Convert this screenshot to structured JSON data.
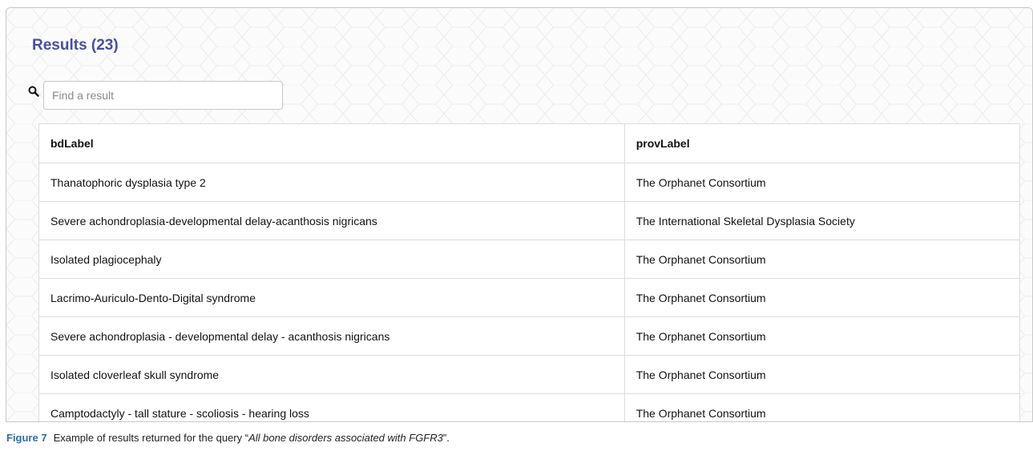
{
  "results": {
    "title": "Results (23)"
  },
  "search": {
    "placeholder": "Find a result",
    "value": "",
    "icon": "search-icon"
  },
  "table": {
    "headers": [
      "bdLabel",
      "provLabel"
    ],
    "rows": [
      [
        "Thanatophoric dysplasia type 2",
        "The Orphanet Consortium"
      ],
      [
        "Severe achondroplasia-developmental delay-acanthosis nigricans",
        "The International Skeletal Dysplasia Society"
      ],
      [
        "Isolated plagiocephaly",
        "The Orphanet Consortium"
      ],
      [
        "Lacrimo-Auriculo-Dento-Digital syndrome",
        "The Orphanet Consortium"
      ],
      [
        "Severe achondroplasia - developmental delay - acanthosis nigricans",
        "The Orphanet Consortium"
      ],
      [
        "Isolated cloverleaf skull syndrome",
        "The Orphanet Consortium"
      ],
      [
        "Camptodactyly - tall stature - scoliosis - hearing loss",
        "The Orphanet Consortium"
      ]
    ]
  },
  "caption": {
    "label": "Figure 7",
    "text_before": "Example of results returned for the query “",
    "query": "All bone disorders associated with FGFR3",
    "text_after": "”."
  },
  "colors": {
    "title": "#4a4e9e",
    "figure_label": "#2a6fa8",
    "border": "#dcdcdc"
  }
}
